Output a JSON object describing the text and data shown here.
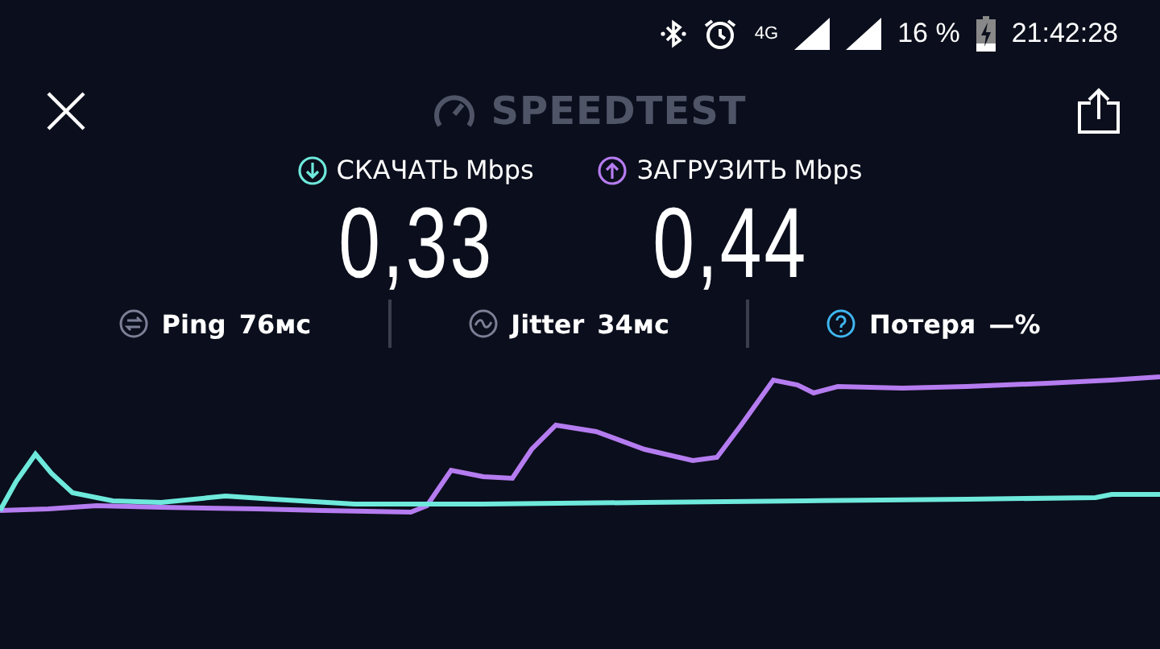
{
  "status_bar": {
    "network": "4G",
    "battery": "16 %",
    "time": "21:42:28"
  },
  "header": {
    "title": "SPEEDTEST"
  },
  "results": [
    {
      "kind": "download",
      "label": "СКАЧАТЬ",
      "unit": "Mbps",
      "value": "0,33"
    },
    {
      "kind": "upload",
      "label": "ЗАГРУЗИТЬ",
      "unit": "Mbps",
      "value": "0,44"
    }
  ],
  "stats": [
    {
      "kind": "ping",
      "label": "Ping",
      "value": "76мс"
    },
    {
      "kind": "jitter",
      "label": "Jitter",
      "value": "34мс"
    },
    {
      "kind": "loss",
      "label": "Потеря",
      "value": "—%"
    }
  ]
}
